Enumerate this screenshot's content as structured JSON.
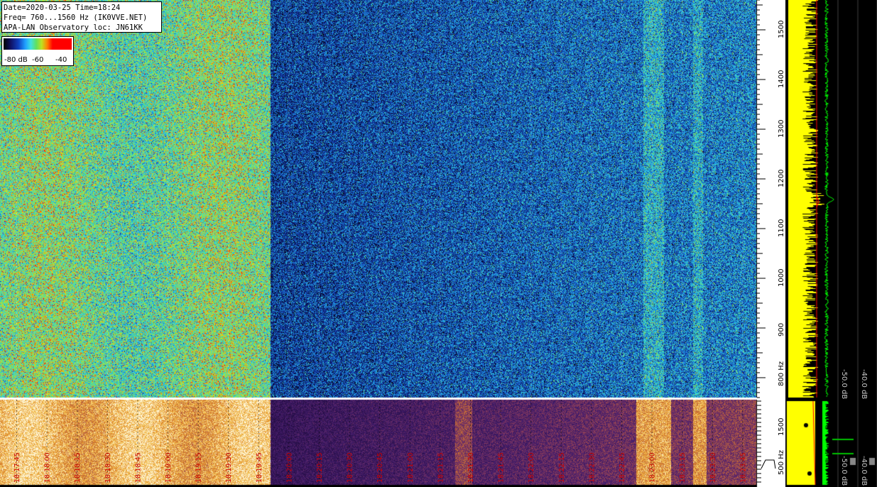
{
  "header": {
    "line1": "Date=2020-03-25 Time=18:24",
    "line2": "Freq= 760...1560 Hz (IK0VVE.NET)",
    "line3": "APA-LAN Observatory loc: JN61KK"
  },
  "colorbar": {
    "label_low": "-80 dB",
    "label_mid": "-60",
    "label_high": "-40"
  },
  "freq_axis": {
    "labels": [
      "1500",
      "1400",
      "1300",
      "1200",
      "1100",
      "1000",
      "900",
      "800 Hz"
    ],
    "values": [
      1500,
      1400,
      1300,
      1200,
      1100,
      1000,
      900,
      800
    ]
  },
  "lower_axis": {
    "labels": [
      "1500",
      "500 Hz"
    ],
    "values": [
      1500,
      500
    ]
  },
  "level_labels": {
    "upper": [
      "-50.0 dB",
      "-40.0 dB"
    ],
    "lower": [
      "-50.0 dB",
      "-40.0 dB"
    ]
  },
  "time_labels": [
    "18:17:45",
    "18:18:00",
    "18:18:15",
    "18:18:30",
    "18:18:45",
    "18:19:00",
    "18:19:15",
    "18:19:30",
    "18:19:45",
    "18:20:00",
    "18:20:15",
    "18:20:30",
    "18:20:45",
    "18:21:00",
    "18:21:15",
    "18:21:30",
    "18:21:45",
    "18:22:00",
    "18:22:15",
    "18:22:30",
    "18:22:45",
    "18:23:00",
    "18:23:15",
    "18:23:30",
    "18:23:45"
  ],
  "colors": {
    "spectrum_trace": "#ffff00",
    "level_trace": "#00ff00",
    "marker_line": "#ff0000",
    "time_label": "#cc0000"
  }
}
